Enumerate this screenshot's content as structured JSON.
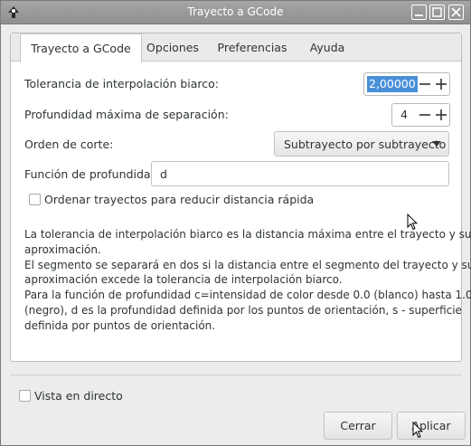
{
  "window": {
    "title": "Trayecto a GCode"
  },
  "tabs": [
    {
      "label": "Trayecto a GCode",
      "active": true
    },
    {
      "label": "Opciones",
      "active": false
    },
    {
      "label": "Preferencias",
      "active": false
    },
    {
      "label": "Ayuda",
      "active": false
    }
  ],
  "form": {
    "tolerance_label": "Tolerancia de interpolación biarco:",
    "tolerance_value": "2,00000",
    "depth_label": "Profundidad máxima de separación:",
    "depth_value": "4",
    "order_label": "Orden de corte:",
    "order_value": "Subtrayecto por subtrayecto",
    "depth_function_label": "Función de profundidad:",
    "depth_function_value": "d",
    "sort_paths_label": "Ordenar trayectos para reducir distancia rápida",
    "sort_paths_checked": false
  },
  "help_text": [
    "La tolerancia de interpolación biarco es la distancia máxima entre el trayecto y su",
    "aproximación.",
    "El segmento se separará en dos si la distancia entre el segmento del trayecto y su",
    "aproximación excede la tolerancia de interpolación biarco.",
    "Para la función de profundidad c=intensidad de color desde 0.0 (blanco) hasta 1.0",
    "(negro), d es la profundidad definida por los puntos de orientación, s - superficie",
    "definida por puntos de orientación."
  ],
  "live_preview": {
    "label": "Vista en directo",
    "checked": false
  },
  "buttons": {
    "close": "Cerrar",
    "apply": "Aplicar"
  },
  "colors": {
    "titlebar": "#9a9a9a",
    "selection": "#4a90d9",
    "window_bg": "#ececec"
  },
  "icons": [
    "inkscape-icon",
    "minimize-icon",
    "maximize-icon",
    "close-icon",
    "minus-icon",
    "plus-icon",
    "chevron-down-icon",
    "mouse-pointer-icon"
  ]
}
